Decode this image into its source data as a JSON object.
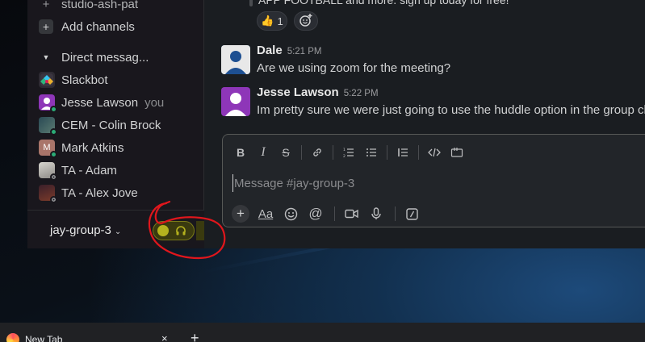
{
  "sidebar": {
    "channels": [
      {
        "label": "studio-ash-pat"
      }
    ],
    "add_channels": "Add channels",
    "dm_header": "Direct messag...",
    "dms": [
      {
        "label": "Slackbot",
        "you": "",
        "status": "none"
      },
      {
        "label": "Jesse Lawson",
        "you": "you",
        "status": "online"
      },
      {
        "label": "CEM - Colin Brock",
        "you": "",
        "status": "online"
      },
      {
        "label": "Mark Atkins",
        "you": "",
        "status": "online"
      },
      {
        "label": "TA - Adam",
        "you": "",
        "status": "away"
      },
      {
        "label": "TA - Alex Jove",
        "you": "",
        "status": "away"
      }
    ],
    "workspace": {
      "name": "jay-group-3",
      "huddle_icon": "headphones-icon"
    }
  },
  "messages": {
    "previous_line": "APP FOOTBALL and more. sign up today for free!",
    "reactions": [
      {
        "emoji": "👍",
        "count": "1"
      }
    ],
    "items": [
      {
        "author": "Dale",
        "time": "5:21 PM",
        "text": "Are we using zoom for the meeting?",
        "avatar_color": "#1264a3"
      },
      {
        "author": "Jesse Lawson",
        "time": "5:22 PM",
        "text": "Im pretty sure we were just going to use the huddle option in the group ch",
        "avatar_color": "#8e36b8"
      }
    ]
  },
  "composer": {
    "placeholder": "Message #jay-group-3",
    "formatting": [
      "bold-icon",
      "italic-icon",
      "strikethrough-icon",
      "link-icon",
      "ordered-list-icon",
      "bulleted-list-icon",
      "blockquote-icon",
      "code-icon",
      "code-block-icon"
    ],
    "actions": [
      "plus-icon",
      "text-format-icon",
      "emoji-icon",
      "mention-icon",
      "video-icon",
      "microphone-icon",
      "slash-command-icon"
    ],
    "text_format_label": "Aa"
  },
  "browser": {
    "tab_title": "New Tab",
    "close_glyph": "×",
    "new_tab_glyph": "+"
  },
  "colors": {
    "sidebar_bg": "#19171d",
    "main_bg": "#1a1d21",
    "huddle_green": "#b5b21e",
    "annotation_red": "#e0161c",
    "online": "#2bac76"
  }
}
